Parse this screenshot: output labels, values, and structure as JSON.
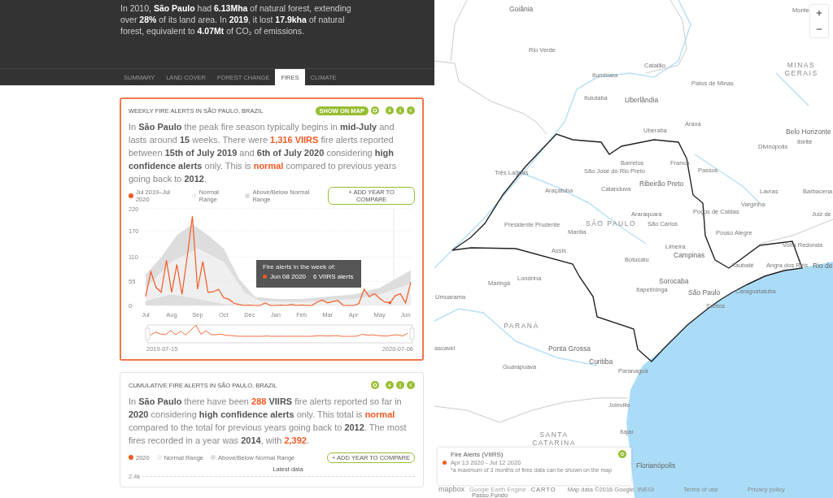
{
  "header": {
    "text": "In 2010, **São Paulo** had **6.13Mha** of natural forest, extending over **28%** of its land area. In **2019**, it lost **17.9kha** of natural forest, equivalent to **4.07Mt** of CO₂ of emissions."
  },
  "tabs": [
    {
      "label": "SUMMARY",
      "selected": false
    },
    {
      "label": "LAND COVER",
      "selected": false
    },
    {
      "label": "FOREST CHANGE",
      "selected": false
    },
    {
      "label": "FIRES",
      "selected": true
    },
    {
      "label": "CLIMATE",
      "selected": false
    }
  ],
  "weekly_card": {
    "title": "WEEKLY FIRE ALERTS IN SÃO PAULO, BRAZIL",
    "show_on_map": "SHOW ON MAP",
    "selected": true,
    "sentence": [
      {
        "kind": "plain",
        "text": "In "
      },
      {
        "kind": "bold",
        "text": "São Paulo"
      },
      {
        "kind": "plain",
        "text": " the peak fire season typically begins in "
      },
      {
        "kind": "bold",
        "text": "mid-July"
      },
      {
        "kind": "plain",
        "text": " and lasts around "
      },
      {
        "kind": "bold",
        "text": "15"
      },
      {
        "kind": "plain",
        "text": " weeks. There were "
      },
      {
        "kind": "alert",
        "text": "1,316 VIIRS"
      },
      {
        "kind": "plain",
        "text": " fire alerts reported between "
      },
      {
        "kind": "bold",
        "text": "15th of July 2019"
      },
      {
        "kind": "plain",
        "text": " and "
      },
      {
        "kind": "bold",
        "text": "6th of July 2020"
      },
      {
        "kind": "plain",
        "text": " considering "
      },
      {
        "kind": "bold",
        "text": "high confidence alerts"
      },
      {
        "kind": "plain",
        "text": " only. This is "
      },
      {
        "kind": "alert",
        "text": "normal"
      },
      {
        "kind": "plain",
        "text": " compared to previous years going back to "
      },
      {
        "kind": "bold",
        "text": "2012"
      },
      {
        "kind": "plain",
        "text": "."
      }
    ],
    "legend": [
      {
        "label": "Normal Range",
        "color": "#efefef"
      },
      {
        "label": "Above/Below Normal Range",
        "color": "#dddddd"
      }
    ],
    "compare_button": "+ ADD YEAR TO COMPARE",
    "chart_data": {
      "type": "line",
      "grid": true,
      "ylim": [
        0,
        220
      ],
      "yticks": [
        0,
        55,
        110,
        170,
        220
      ],
      "categories": [
        "Jul",
        null,
        null,
        null,
        null,
        "Aug",
        null,
        null,
        null,
        null,
        "Sep",
        null,
        null,
        null,
        null,
        "Oct",
        null,
        null,
        null,
        null,
        "Dec",
        null,
        null,
        null,
        null,
        "Jan",
        null,
        null,
        null,
        null,
        "Feb",
        null,
        null,
        null,
        null,
        "Mar",
        null,
        null,
        null,
        null,
        "Apr",
        null,
        null,
        null,
        null,
        "May",
        null,
        null,
        null,
        null,
        "Jun",
        null
      ],
      "series": [
        {
          "name": "Jul 2019–Jul 2020",
          "color": "#f15a24",
          "values": [
            20,
            77,
            41,
            30,
            103,
            30,
            93,
            25,
            110,
            203,
            37,
            100,
            30,
            31,
            37,
            18,
            14,
            5,
            2,
            0,
            1,
            0,
            0,
            6,
            0,
            0,
            1,
            0,
            2,
            0,
            1,
            0,
            0,
            8,
            12,
            6,
            9,
            11,
            0,
            0,
            0,
            4,
            37,
            20,
            27,
            16,
            8,
            6,
            22,
            27,
            6,
            53
          ]
        }
      ]
    },
    "tooltip": {
      "title": "Fire alerts in the week of:",
      "date": "Jun 08 2020",
      "count": "6 VIIRS alerts"
    },
    "brush": {
      "start": "2019-07-15",
      "end": "2020-07-06"
    }
  },
  "cumulative_card": {
    "title": "CUMULATIVE FIRE ALERTS IN SÃO PAULO, BRAZIL",
    "selected": false,
    "sentence": [
      {
        "kind": "plain",
        "text": "In "
      },
      {
        "kind": "bold",
        "text": "São Paulo"
      },
      {
        "kind": "plain",
        "text": " there have been "
      },
      {
        "kind": "alert",
        "text": "288"
      },
      {
        "kind": "bold",
        "text": " VIIRS"
      },
      {
        "kind": "plain",
        "text": " fire alerts reported so far in "
      },
      {
        "kind": "bold",
        "text": "2020"
      },
      {
        "kind": "plain",
        "text": " considering "
      },
      {
        "kind": "bold",
        "text": "high confidence alerts"
      },
      {
        "kind": "plain",
        "text": " only. This total is "
      },
      {
        "kind": "alert",
        "text": "normal"
      },
      {
        "kind": "plain",
        "text": " compared to the total for previous years going back to "
      },
      {
        "kind": "bold",
        "text": "2012"
      },
      {
        "kind": "plain",
        "text": ". The most fires recorded in a year was "
      },
      {
        "kind": "bold",
        "text": "2014"
      },
      {
        "kind": "plain",
        "text": ", with "
      },
      {
        "kind": "alert",
        "text": "2,392"
      },
      {
        "kind": "plain",
        "text": "."
      }
    ],
    "legend": [
      {
        "label": "2020",
        "color": "#f15a24"
      },
      {
        "label": "Normal Range",
        "color": "#efefef"
      },
      {
        "label": "Above/Below Normal Range",
        "color": "#dddddd"
      }
    ],
    "compare_button": "+ ADD YEAR TO COMPARE",
    "top_tick": "2.4k",
    "marker_label": "Latest data"
  },
  "map": {
    "labels": [
      {
        "text": "Goiânia",
        "kind": "city-large"
      },
      {
        "text": "Monte",
        "kind": "city"
      },
      {
        "text": "Rio Verde",
        "kind": "city"
      },
      {
        "text": "Catalão",
        "kind": "city"
      },
      {
        "text": "MINAS GERAIS",
        "kind": "state"
      },
      {
        "text": "Itumbiara",
        "kind": "city"
      },
      {
        "text": "Patos de Minas",
        "kind": "city"
      },
      {
        "text": "Ituiutaba",
        "kind": "city"
      },
      {
        "text": "Uberlândia",
        "kind": "city-large"
      },
      {
        "text": "Araxá",
        "kind": "city"
      },
      {
        "text": "Uberaba",
        "kind": "city"
      },
      {
        "text": "Belo Horizonte",
        "kind": "city-large"
      },
      {
        "text": "Ibirité",
        "kind": "city"
      },
      {
        "text": "Divinópolis",
        "kind": "city"
      },
      {
        "text": "Barretos",
        "kind": "city"
      },
      {
        "text": "Franca",
        "kind": "city"
      },
      {
        "text": "Três Lagoas",
        "kind": "city"
      },
      {
        "text": "São José do Rio Preto",
        "kind": "city"
      },
      {
        "text": "Passos",
        "kind": "city"
      },
      {
        "text": "Ribeirão Preto",
        "kind": "city-large"
      },
      {
        "text": "Araçatuba",
        "kind": "city"
      },
      {
        "text": "Catanduva",
        "kind": "city"
      },
      {
        "text": "Lavras",
        "kind": "city"
      },
      {
        "text": "Barbacena",
        "kind": "city"
      },
      {
        "text": "Varginha",
        "kind": "city"
      },
      {
        "text": "Araraquara",
        "kind": "city"
      },
      {
        "text": "Poços de Caldas",
        "kind": "city"
      },
      {
        "text": "Juiz de",
        "kind": "city"
      },
      {
        "text": "Presidente Prudente",
        "kind": "city"
      },
      {
        "text": "SÃO PAULO",
        "kind": "state"
      },
      {
        "text": "São Carlos",
        "kind": "city"
      },
      {
        "text": "Marília",
        "kind": "city"
      },
      {
        "text": "Pouso Alegre",
        "kind": "city"
      },
      {
        "text": "Limeira",
        "kind": "city"
      },
      {
        "text": "Volta Redonda",
        "kind": "city"
      },
      {
        "text": "Assis",
        "kind": "city"
      },
      {
        "text": "Campinas",
        "kind": "city-large"
      },
      {
        "text": "Botucatu",
        "kind": "city"
      },
      {
        "text": "Taubaté",
        "kind": "city"
      },
      {
        "text": "Angra dos Reis",
        "kind": "city"
      },
      {
        "text": "Rio de",
        "kind": "city-large"
      },
      {
        "text": "Maringá",
        "kind": "city"
      },
      {
        "text": "Londrina",
        "kind": "city"
      },
      {
        "text": "Sorocaba",
        "kind": "city-large"
      },
      {
        "text": "Itapetininga",
        "kind": "city"
      },
      {
        "text": "São Paulo",
        "kind": "city-large"
      },
      {
        "text": "Caraguatatuba",
        "kind": "city"
      },
      {
        "text": "Umuarama",
        "kind": "city"
      },
      {
        "text": "Santos",
        "kind": "city"
      },
      {
        "text": "PARANÁ",
        "kind": "state"
      },
      {
        "text": "ascavel",
        "kind": "city"
      },
      {
        "text": "Ponta Grossa",
        "kind": "city-large"
      },
      {
        "text": "Curitiba",
        "kind": "city-large"
      },
      {
        "text": "Guarapuava",
        "kind": "city"
      },
      {
        "text": "Paranaguá",
        "kind": "city"
      },
      {
        "text": "Joinville",
        "kind": "city"
      },
      {
        "text": "SANTA CATARINA",
        "kind": "state"
      },
      {
        "text": "Itajaí",
        "kind": "city"
      },
      {
        "text": "Florianópolis",
        "kind": "city-large"
      },
      {
        "text": "Passo Fundo",
        "kind": "city"
      }
    ],
    "legend": {
      "title": "Fire Alerts (VIIRS)",
      "range": "Apr 13 2020 - Jul 12 2020",
      "note": "*a maximum of 3 months of fires data can be shown on the map",
      "color": "#f15a24"
    },
    "attribution": {
      "mapbox": "mapbox",
      "gee": "Google Earth Engine",
      "carto": "CARTO",
      "data": "Map data ©2016 Google, INEGI",
      "terms": "Terms of use",
      "privacy": "Privacy policy"
    }
  }
}
